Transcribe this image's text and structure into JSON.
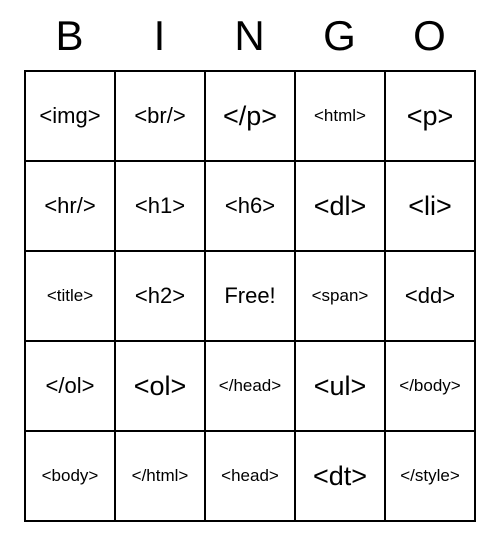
{
  "headers": [
    "B",
    "I",
    "N",
    "G",
    "O"
  ],
  "grid": [
    [
      {
        "text": "<img>",
        "size": "normal"
      },
      {
        "text": "<br/>",
        "size": "normal"
      },
      {
        "text": "</p>",
        "size": "large"
      },
      {
        "text": "<html>",
        "size": "small"
      },
      {
        "text": "<p>",
        "size": "large"
      }
    ],
    [
      {
        "text": "<hr/>",
        "size": "normal"
      },
      {
        "text": "<h1>",
        "size": "normal"
      },
      {
        "text": "<h6>",
        "size": "normal"
      },
      {
        "text": "<dl>",
        "size": "large"
      },
      {
        "text": "<li>",
        "size": "large"
      }
    ],
    [
      {
        "text": "<title>",
        "size": "small"
      },
      {
        "text": "<h2>",
        "size": "normal"
      },
      {
        "text": "Free!",
        "size": "normal"
      },
      {
        "text": "<span>",
        "size": "small"
      },
      {
        "text": "<dd>",
        "size": "normal"
      }
    ],
    [
      {
        "text": "</ol>",
        "size": "normal"
      },
      {
        "text": "<ol>",
        "size": "large"
      },
      {
        "text": "</head>",
        "size": "small"
      },
      {
        "text": "<ul>",
        "size": "large"
      },
      {
        "text": "</body>",
        "size": "small"
      }
    ],
    [
      {
        "text": "<body>",
        "size": "small"
      },
      {
        "text": "</html>",
        "size": "small"
      },
      {
        "text": "<head>",
        "size": "small"
      },
      {
        "text": "<dt>",
        "size": "large"
      },
      {
        "text": "</style>",
        "size": "small"
      }
    ]
  ]
}
